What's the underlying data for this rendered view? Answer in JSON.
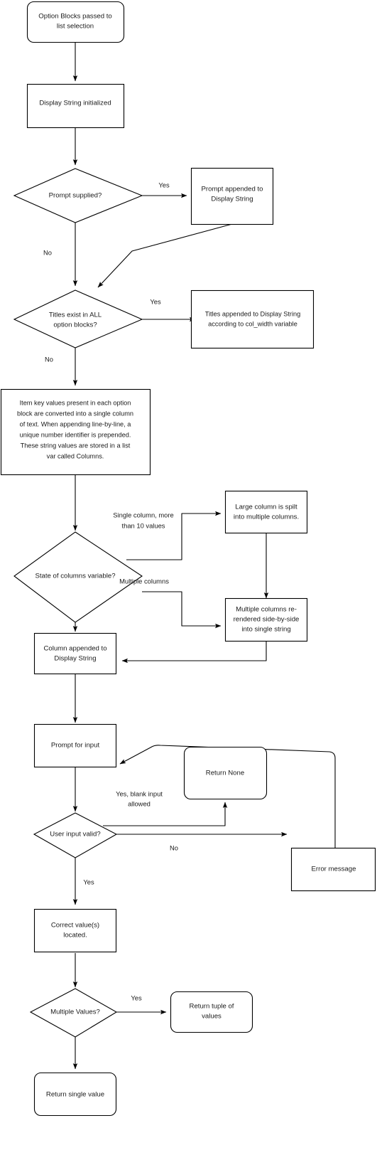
{
  "diagram": {
    "title": "List selection flowchart",
    "background_color": "#ffffff",
    "stroke_color": "#000000",
    "text_color": "#1a1a1a"
  },
  "nodes": {
    "start": {
      "shape": "rounded-rectangle",
      "lines": [
        "Option Blocks passed to",
        "list selection"
      ]
    },
    "display_string_init": {
      "shape": "rectangle",
      "lines": [
        "Display String initialized"
      ]
    },
    "prompt_supplied": {
      "shape": "diamond",
      "lines": [
        "Prompt supplied?"
      ]
    },
    "prompt_appended": {
      "shape": "rectangle",
      "lines": [
        "Prompt appended to",
        "Display String"
      ]
    },
    "titles_exist": {
      "shape": "diamond",
      "lines": [
        "Titles exist in ALL",
        "option blocks?"
      ]
    },
    "titles_appended": {
      "shape": "rectangle",
      "lines": [
        "Titles appended to Display String",
        "according to col_width variable"
      ]
    },
    "item_key_values": {
      "shape": "rectangle",
      "lines": [
        "Item key values present in each option",
        "block are converted into a single column",
        "of text. When appending line-by-line, a",
        "unique number identifier is prepended.",
        "These string values are stored in a list",
        "var called Columns."
      ]
    },
    "state_of_columns": {
      "shape": "diamond",
      "lines": [
        "State of columns variable?"
      ]
    },
    "large_column_split": {
      "shape": "rectangle",
      "lines": [
        "Large column is spilt",
        "into multiple columns."
      ]
    },
    "multiple_columns_rendered": {
      "shape": "rectangle",
      "lines": [
        "Multiple columns re-",
        "rendered side-by-side",
        "into single string"
      ]
    },
    "column_appended": {
      "shape": "rectangle",
      "lines": [
        "Column appended to",
        "Display String"
      ]
    },
    "prompt_for_input": {
      "shape": "rectangle",
      "lines": [
        "Prompt for input"
      ]
    },
    "return_none": {
      "shape": "rounded-rectangle",
      "lines": [
        "Return None"
      ]
    },
    "user_input_valid": {
      "shape": "diamond",
      "lines": [
        "User input valid?"
      ]
    },
    "error_message": {
      "shape": "rectangle",
      "lines": [
        "Error message"
      ]
    },
    "correct_values_located": {
      "shape": "rectangle",
      "lines": [
        "Correct value(s)",
        "located."
      ]
    },
    "multiple_values": {
      "shape": "diamond",
      "lines": [
        "Multiple Values?"
      ]
    },
    "return_tuple": {
      "shape": "rounded-rectangle",
      "lines": [
        "Return tuple of",
        "values"
      ]
    },
    "return_single": {
      "shape": "rounded-rectangle",
      "lines": [
        "Return single value"
      ]
    }
  },
  "edge_labels": {
    "prompt_supplied_yes": "Yes",
    "prompt_supplied_no": "No",
    "titles_exist_yes": "Yes",
    "titles_exist_no": "No",
    "state_single_column": [
      "Single column, more",
      "than 10 values"
    ],
    "state_multiple_columns": "Multiple columns",
    "input_valid_blank": [
      "Yes, blank input",
      "allowed"
    ],
    "input_valid_no": "No",
    "input_valid_yes": "Yes",
    "multiple_values_yes": "Yes"
  }
}
